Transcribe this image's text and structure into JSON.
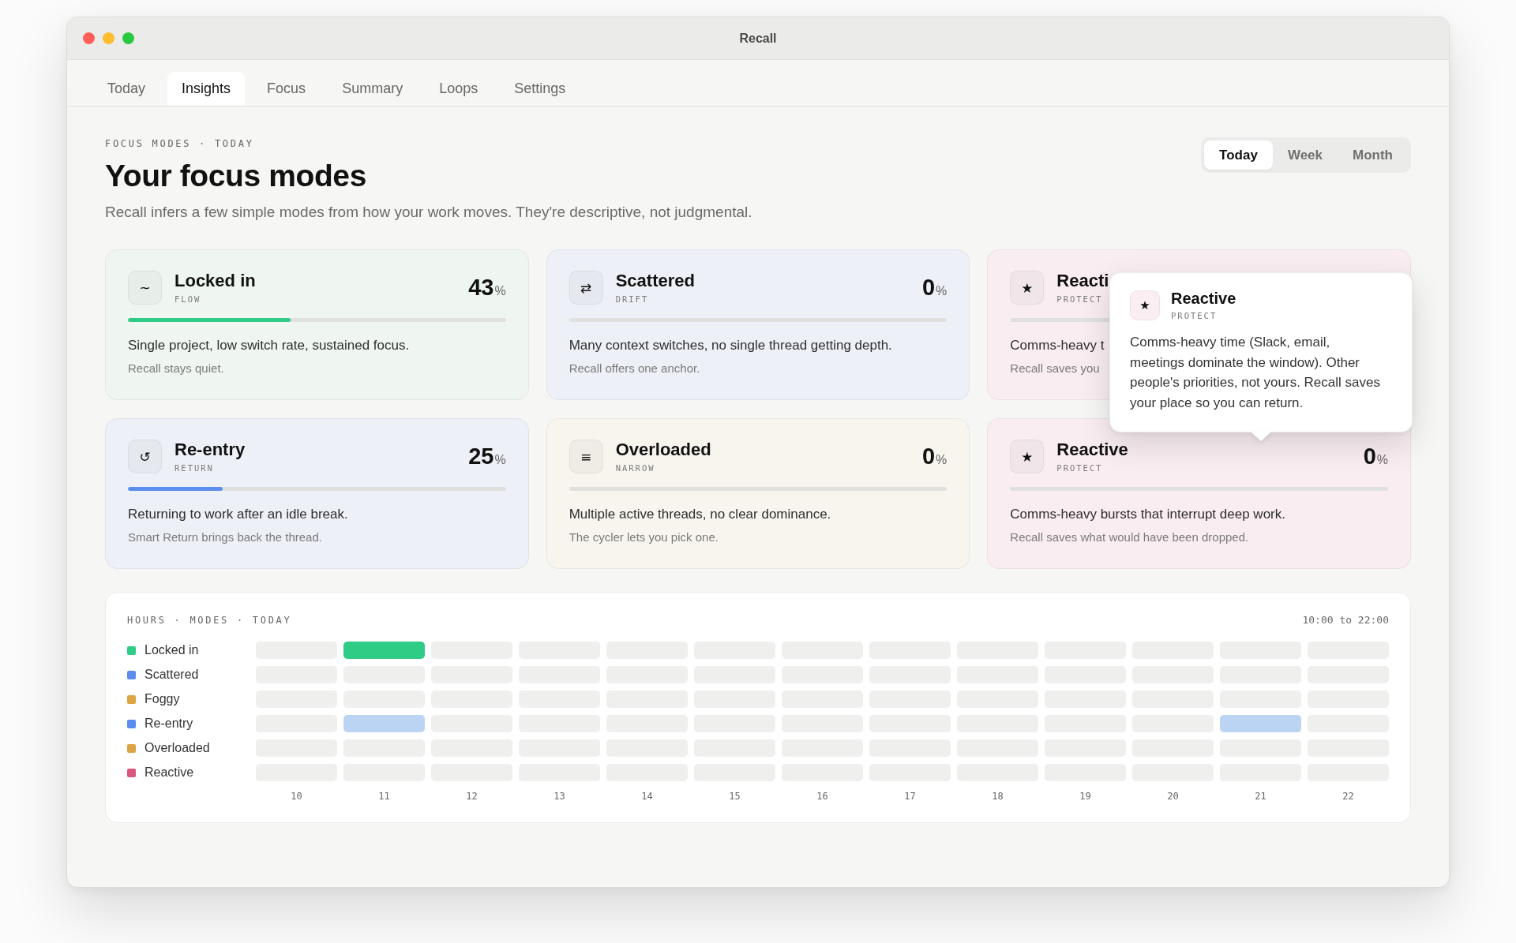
{
  "window": {
    "title": "Recall"
  },
  "tabs": [
    {
      "label": "Today",
      "selected": false
    },
    {
      "label": "Insights",
      "selected": true
    },
    {
      "label": "Focus",
      "selected": false
    },
    {
      "label": "Summary",
      "selected": false
    },
    {
      "label": "Loops",
      "selected": false
    },
    {
      "label": "Settings",
      "selected": false
    }
  ],
  "header": {
    "eyebrow": "FOCUS MODES · TODAY",
    "title": "Your focus modes",
    "subtitle": "Recall infers a few simple modes from how your work moves. They're descriptive, not judgmental."
  },
  "range": [
    {
      "label": "Today",
      "selected": true
    },
    {
      "label": "Week",
      "selected": false
    },
    {
      "label": "Month",
      "selected": false
    }
  ],
  "modes": [
    {
      "icon": "~",
      "name": "Locked in",
      "tag": "FLOW",
      "percent": "43",
      "unit": "%",
      "color": "#eff6f1",
      "bar": {
        "level": 0.43,
        "color": "#2ecc85"
      },
      "description": "Single project, low switch rate, sustained focus.",
      "note": "Recall stays quiet."
    },
    {
      "icon": "⇄",
      "name": "Scattered",
      "tag": "DRIFT",
      "percent": "0",
      "unit": "%",
      "color": "#eef0f8",
      "description": "Many context switches, no single thread getting depth.",
      "note": "Recall offers one anchor."
    },
    {
      "icon": "★",
      "name": "Reacti",
      "tag": "PROTECT",
      "color": "#f9edf1",
      "description": "Comms-heavy t",
      "note": "Recall saves you"
    },
    {
      "icon": "↺",
      "name": "Re-entry",
      "tag": "RETURN",
      "percent": "25",
      "unit": "%",
      "color": "#eef0f8",
      "bar": {
        "level": 0.25,
        "color": "#5b8def"
      },
      "description": "Returning to work after an idle break.",
      "note": "Smart Return brings back the thread."
    },
    {
      "icon": "≡",
      "name": "Overloaded",
      "tag": "NARROW",
      "percent": "0",
      "unit": "%",
      "color": "#f8f5ee",
      "description": "Multiple active threads, no clear dominance.",
      "note": "The cycler lets you pick one."
    },
    {
      "icon": "★",
      "name": "Reactive",
      "tag": "PROTECT",
      "percent": "0",
      "unit": "%",
      "color": "#f9edf1",
      "description": "Comms-heavy bursts that interrupt deep work.",
      "note": "Recall saves what would have been dropped."
    }
  ],
  "tooltip": {
    "icon": "★",
    "name": "Reactive",
    "tag": "PROTECT",
    "text": "Comms-heavy time (Slack, email, meetings dominate the window). Other people's priorities, not yours. Recall saves your place so you can return."
  },
  "timeline": {
    "eyebrow": "HOURS · MODES · TODAY",
    "range": "10:00 to 22:00",
    "rows": [
      {
        "label": "Locked in",
        "color": "#2ecc85",
        "cells": [
          {
            "filled": false
          },
          {
            "filled": true,
            "color": "#2ecc85"
          },
          {
            "filled": false
          },
          {
            "filled": false
          },
          {
            "filled": false
          },
          {
            "filled": false
          },
          {
            "filled": false
          },
          {
            "filled": false
          },
          {
            "filled": false
          },
          {
            "filled": false
          },
          {
            "filled": false
          },
          {
            "filled": false
          },
          {
            "filled": false
          }
        ]
      },
      {
        "label": "Scattered",
        "color": "#5b8def",
        "cells": [
          {
            "filled": false
          },
          {
            "filled": false
          },
          {
            "filled": false
          },
          {
            "filled": false
          },
          {
            "filled": false
          },
          {
            "filled": false
          },
          {
            "filled": false
          },
          {
            "filled": false
          },
          {
            "filled": false
          },
          {
            "filled": false
          },
          {
            "filled": false
          },
          {
            "filled": false
          },
          {
            "filled": false
          }
        ]
      },
      {
        "label": "Foggy",
        "color": "#dca445",
        "cells": [
          {
            "filled": false
          },
          {
            "filled": false
          },
          {
            "filled": false
          },
          {
            "filled": false
          },
          {
            "filled": false
          },
          {
            "filled": false
          },
          {
            "filled": false
          },
          {
            "filled": false
          },
          {
            "filled": false
          },
          {
            "filled": false
          },
          {
            "filled": false
          },
          {
            "filled": false
          },
          {
            "filled": false
          }
        ]
      },
      {
        "label": "Re-entry",
        "color": "#5b8def",
        "cells": [
          {
            "filled": false
          },
          {
            "filled": true,
            "color": "#bcd4f4"
          },
          {
            "filled": false
          },
          {
            "filled": false
          },
          {
            "filled": false
          },
          {
            "filled": false
          },
          {
            "filled": false
          },
          {
            "filled": false
          },
          {
            "filled": false
          },
          {
            "filled": false
          },
          {
            "filled": false
          },
          {
            "filled": true,
            "color": "#bcd4f4"
          },
          {
            "filled": false
          }
        ]
      },
      {
        "label": "Overloaded",
        "color": "#dca445",
        "cells": [
          {
            "filled": false
          },
          {
            "filled": false
          },
          {
            "filled": false
          },
          {
            "filled": false
          },
          {
            "filled": false
          },
          {
            "filled": false
          },
          {
            "filled": false
          },
          {
            "filled": false
          },
          {
            "filled": false
          },
          {
            "filled": false
          },
          {
            "filled": false
          },
          {
            "filled": false
          },
          {
            "filled": false
          }
        ]
      },
      {
        "label": "Reactive",
        "color": "#d9577c",
        "cells": [
          {
            "filled": false
          },
          {
            "filled": false
          },
          {
            "filled": false
          },
          {
            "filled": false
          },
          {
            "filled": false
          },
          {
            "filled": false
          },
          {
            "filled": false
          },
          {
            "filled": false
          },
          {
            "filled": false
          },
          {
            "filled": false
          },
          {
            "filled": false
          },
          {
            "filled": false
          },
          {
            "filled": false
          }
        ]
      }
    ],
    "hours": [
      "10",
      "11",
      "12",
      "13",
      "14",
      "15",
      "16",
      "17",
      "18",
      "19",
      "20",
      "21",
      "22"
    ]
  }
}
